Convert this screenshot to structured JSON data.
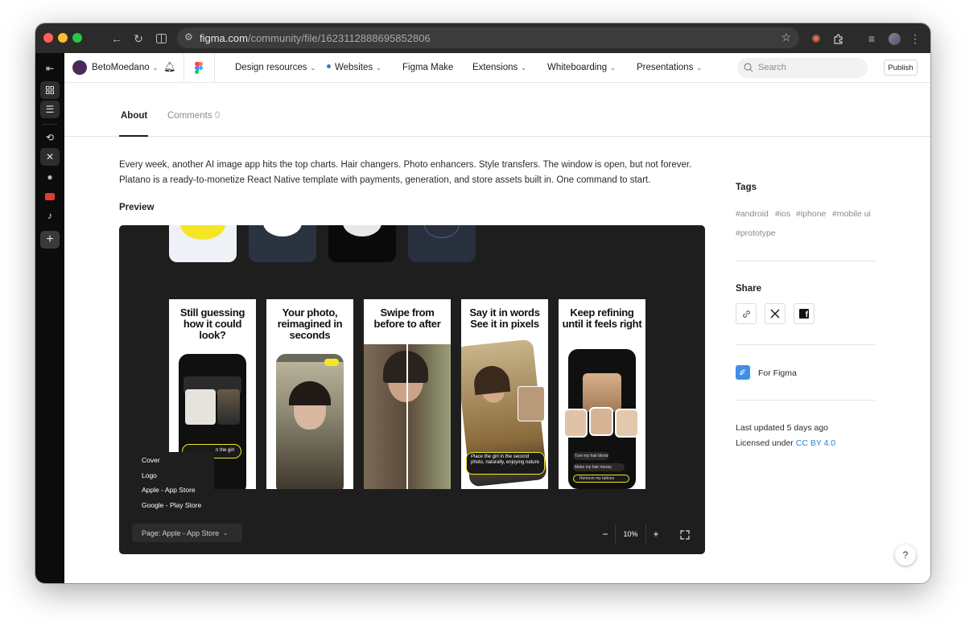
{
  "browser": {
    "url_host": "figma.com",
    "url_path": "/community/file/1623112888695852806"
  },
  "nav": {
    "username": "BetoMoedano",
    "items": [
      {
        "label": "Design resources",
        "dropdown": true
      },
      {
        "label": "Websites",
        "dropdown": true,
        "dot": true
      },
      {
        "label": "Figma Make",
        "dropdown": false
      },
      {
        "label": "Extensions",
        "dropdown": true
      },
      {
        "label": "Whiteboarding",
        "dropdown": true
      },
      {
        "label": "Presentations",
        "dropdown": true
      }
    ],
    "search_placeholder": "Search",
    "publish_label": "Publish"
  },
  "tabs": {
    "about": "About",
    "comments": "Comments",
    "comments_count": "0"
  },
  "description": "Every week, another AI image app hits the top charts. Hair changers. Photo enhancers. Style transfers. The window is open, but not forever. Platano is a ready-to-monetize React Native template with payments, generation, and store assets built in. One command to start.",
  "preview": {
    "heading": "Preview",
    "cards": [
      {
        "title": "Still guessing how it could look?"
      },
      {
        "title": "Your photo, reimagined in seconds"
      },
      {
        "title": "Swipe from before to after"
      },
      {
        "title": "Say it in words See it in pixels"
      },
      {
        "title": "Keep refining until it feels right"
      }
    ],
    "phone_texts": {
      "chip1": "n the girl",
      "chip4": "Place the girl in the second photo, naturally, enjoying nature",
      "chip5a": "Turn my hair blond",
      "chip5b": "Make my hair messy",
      "chip5c": "Remove my tattoos"
    },
    "frames": [
      "Cover",
      "Logo",
      "Apple - App Store",
      "Google - Play Store"
    ],
    "page_selector": "Page: Apple - App Store",
    "zoom": "10%",
    "zoom_minus": "−",
    "zoom_plus": "+"
  },
  "sidebar_right": {
    "tags_heading": "Tags",
    "tags": [
      "#android",
      "#ios",
      "#iphone",
      "#mobile ui",
      "#prototype"
    ],
    "share_heading": "Share",
    "for_figma": "For Figma",
    "last_updated": "Last updated 5 days ago",
    "licensed_prefix": "Licensed under ",
    "license": "CC BY 4.0"
  },
  "help": "?",
  "colors": {
    "accent_yellow": "#f5e625",
    "link_blue": "#2d7fd3",
    "figma_tile": "#3f8fe8",
    "preview_bg": "#1e1e1e"
  }
}
